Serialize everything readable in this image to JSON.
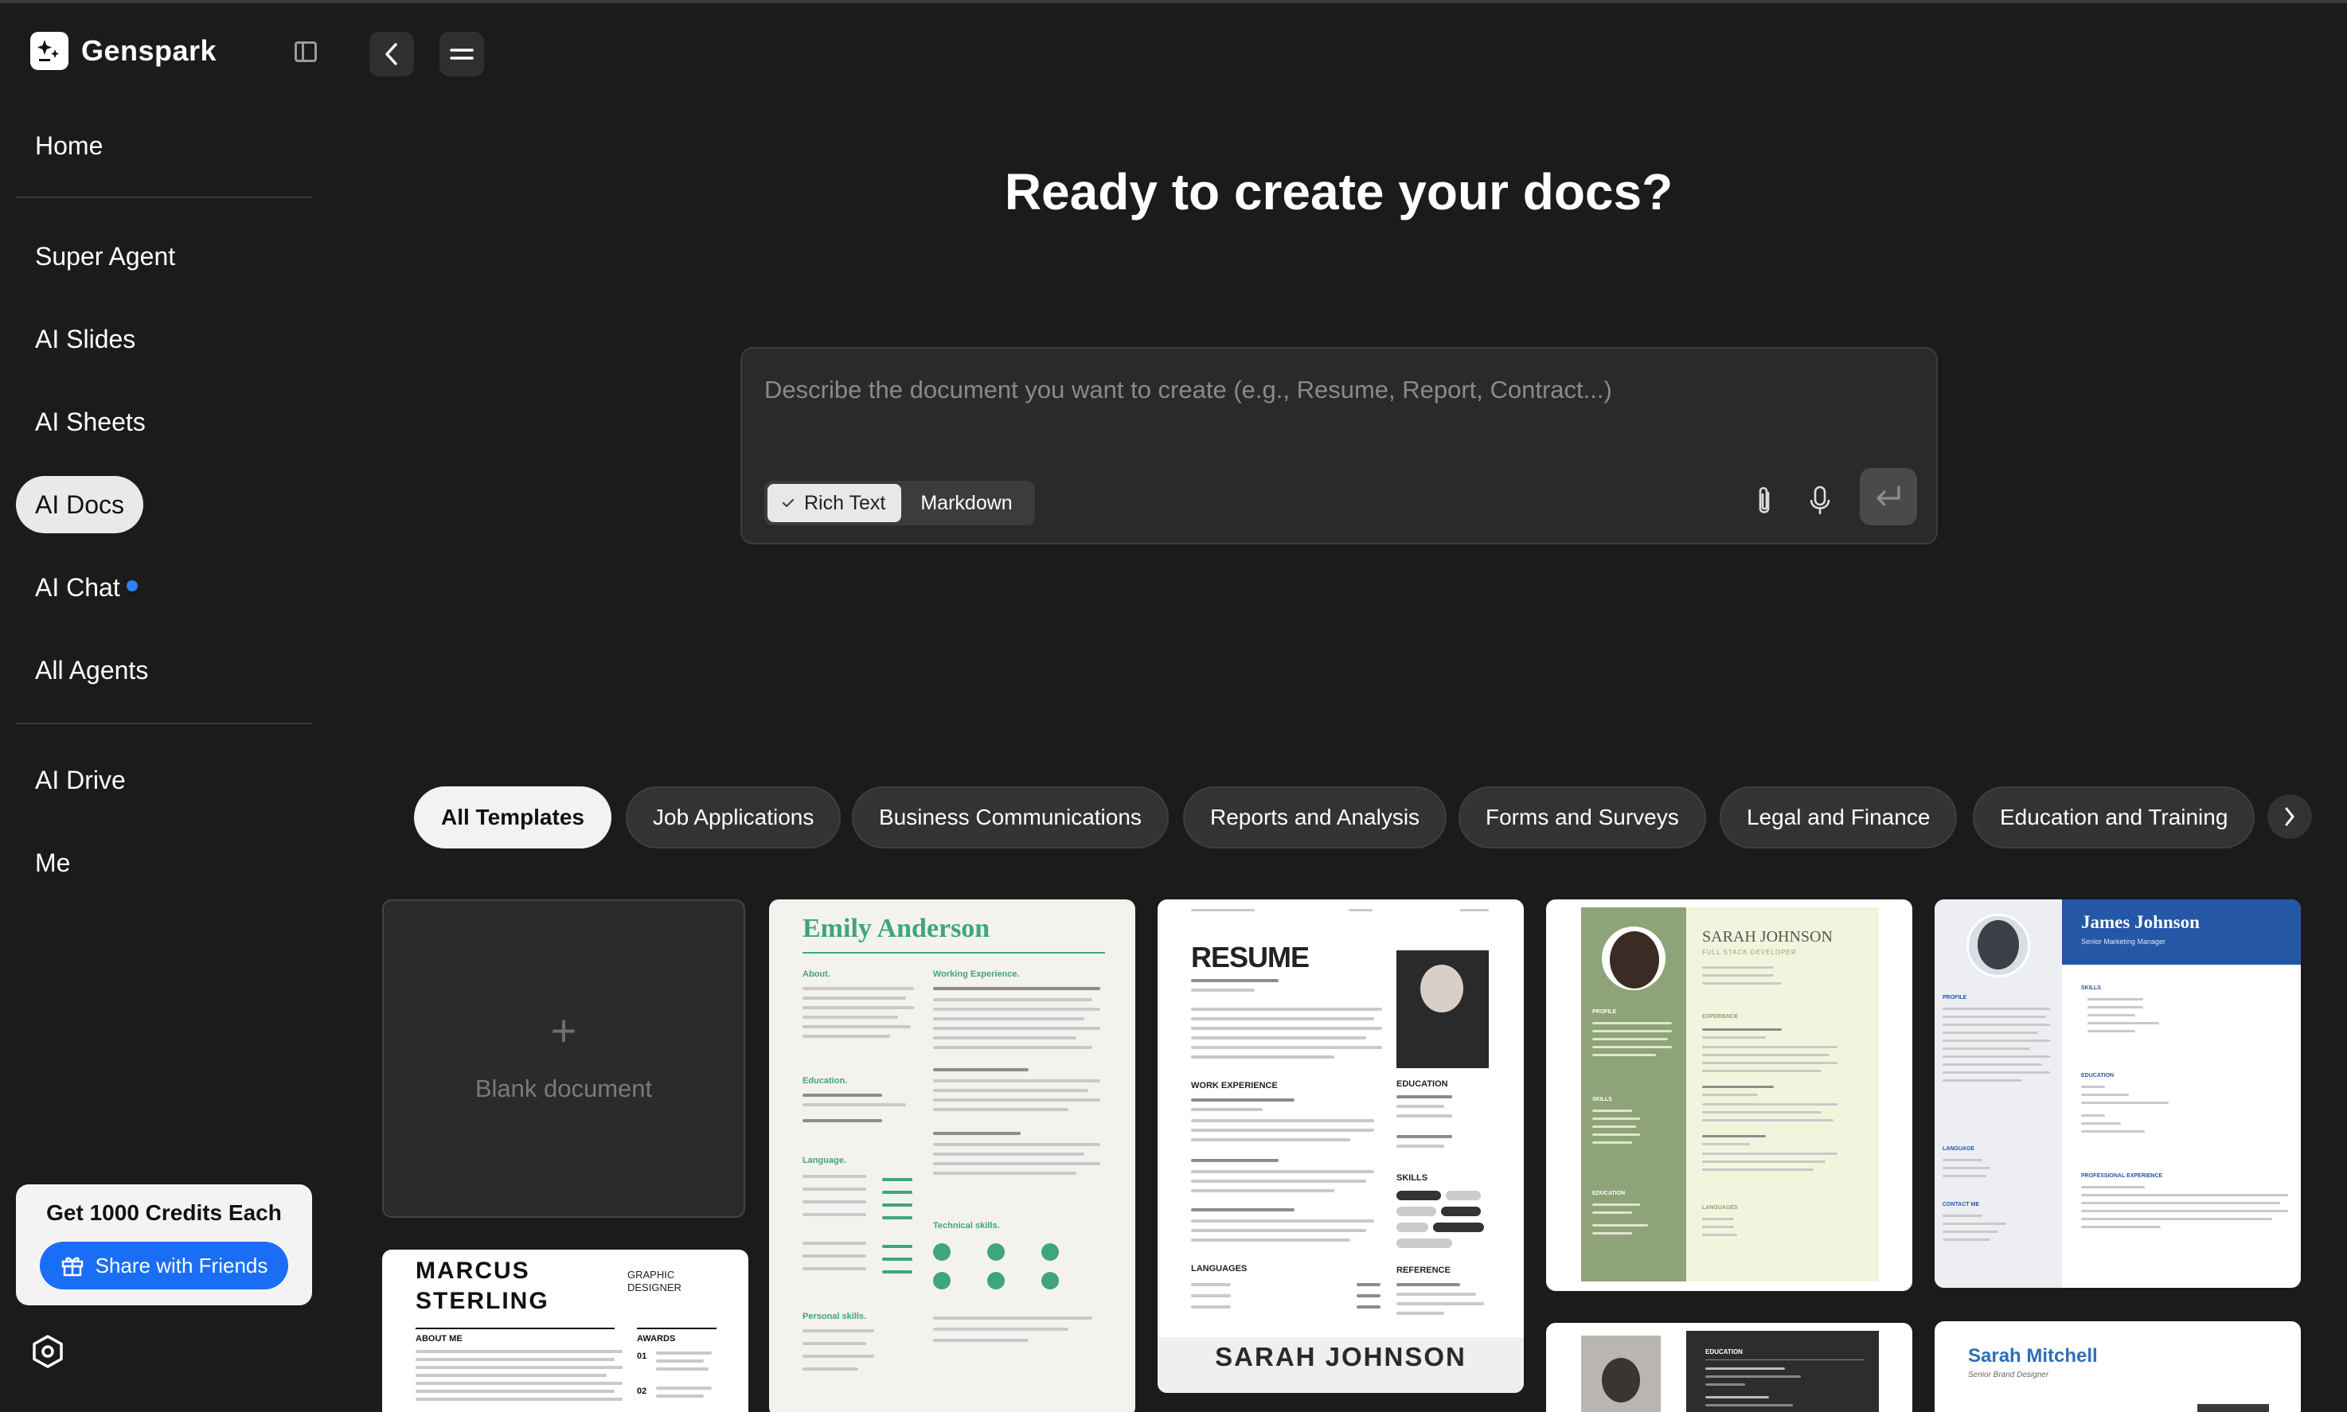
{
  "app": {
    "name": "Genspark"
  },
  "sidebar": {
    "items": [
      {
        "id": "home",
        "label": "Home"
      },
      {
        "id": "super-agent",
        "label": "Super Agent"
      },
      {
        "id": "ai-slides",
        "label": "AI Slides"
      },
      {
        "id": "ai-sheets",
        "label": "AI Sheets"
      },
      {
        "id": "ai-docs",
        "label": "AI Docs",
        "active": true
      },
      {
        "id": "ai-chat",
        "label": "AI Chat",
        "badge_dot": true
      },
      {
        "id": "all-agents",
        "label": "All Agents"
      },
      {
        "id": "ai-drive",
        "label": "AI Drive"
      },
      {
        "id": "me",
        "label": "Me"
      }
    ],
    "credits": {
      "title": "Get 1000 Credits Each",
      "button_label": "Share with Friends"
    }
  },
  "main": {
    "headline": "Ready to create your docs?",
    "prompt": {
      "placeholder": "Describe the document you want to create (e.g., Resume, Report, Contract...)",
      "value": "",
      "formats": [
        {
          "label": "Rich Text",
          "selected": true
        },
        {
          "label": "Markdown",
          "selected": false
        }
      ]
    },
    "categories": [
      {
        "label": "All Templates",
        "active": true
      },
      {
        "label": "Job Applications"
      },
      {
        "label": "Business Communications"
      },
      {
        "label": "Reports and Analysis"
      },
      {
        "label": "Forms and Surveys"
      },
      {
        "label": "Legal and Finance"
      },
      {
        "label": "Education and Training"
      }
    ],
    "templates": {
      "blank_label": "Blank document",
      "emily": {
        "name": "Emily Anderson",
        "about": "About.",
        "education": "Education.",
        "language": "Language.",
        "personal": "Personal skills.",
        "working": "Working Experience.",
        "technical": "Technical skills."
      },
      "resume": {
        "heading": "RESUME",
        "name": "SARAH JOHNSON",
        "work": "WORK EXPERIENCE",
        "education": "EDUCATION",
        "skills": "SKILLS",
        "languages": "LANGUAGES",
        "reference": "REFERENCE"
      },
      "sarah_fs": {
        "name": "SARAH JOHNSON",
        "role": "FULL STACK DEVELOPER",
        "profile": "PROFILE",
        "skills": "SKILLS",
        "education": "EDUCATION",
        "experience": "EXPERIENCE",
        "languages": "LANGUAGES"
      },
      "james": {
        "name": "James Johnson",
        "role": "Senior Marketing Manager",
        "profile": "PROFILE",
        "skills": "SKILLS",
        "education": "EDUCATION",
        "language": "LANGUAGE",
        "contact": "CONTACT ME",
        "experience": "PROFESSIONAL EXPERIENCE"
      },
      "marcus": {
        "name_line1": "MARCUS",
        "name_line2": "STERLING",
        "role_line1": "GRAPHIC",
        "role_line2": "DESIGNER",
        "about": "ABOUT ME",
        "awards": "AWARDS",
        "award1": "01",
        "award2": "02"
      },
      "dark_edu": {
        "education": "EDUCATION"
      },
      "sarah_mitchell": {
        "name": "Sarah Mitchell",
        "role": "Senior Brand Designer"
      }
    }
  },
  "colors": {
    "accent_blue": "#1a6ef5",
    "emily_green": "#3fa57c",
    "sage_green": "#8ea478",
    "james_blue": "#2457a6"
  }
}
